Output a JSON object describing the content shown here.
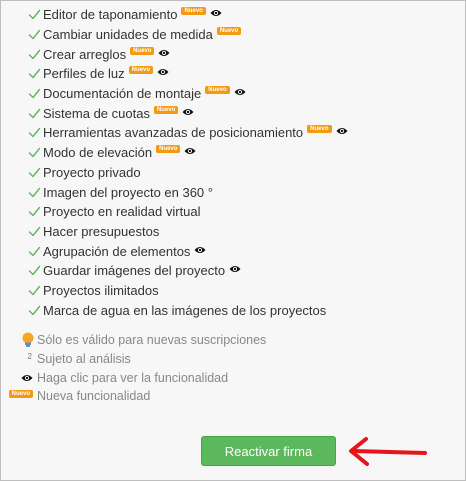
{
  "features": [
    {
      "label": "Editor de taponamiento",
      "new": true,
      "eye": true
    },
    {
      "label": "Cambiar unidades de medida",
      "new": true,
      "eye": false
    },
    {
      "label": "Crear arreglos",
      "new": true,
      "eye": true
    },
    {
      "label": "Perfiles de luz",
      "new": true,
      "eye": true
    },
    {
      "label": "Documentación de montaje",
      "new": true,
      "eye": true
    },
    {
      "label": "Sistema de cuotas",
      "new": true,
      "eye": true
    },
    {
      "label": "Herramientas avanzadas de posicionamiento",
      "new": true,
      "eye": true
    },
    {
      "label": "Modo de elevación",
      "new": true,
      "eye": true
    },
    {
      "label": "Proyecto privado",
      "new": false,
      "eye": false
    },
    {
      "label": "Imagen del proyecto en 360 °",
      "new": false,
      "eye": false
    },
    {
      "label": "Proyecto en realidad virtual",
      "new": false,
      "eye": false
    },
    {
      "label": "Hacer presupuestos",
      "new": false,
      "eye": false
    },
    {
      "label": "Agrupación de elementos",
      "new": false,
      "eye": true
    },
    {
      "label": "Guardar imágenes del proyecto",
      "new": false,
      "eye": true
    },
    {
      "label": "Proyectos ilimitados",
      "new": false,
      "eye": false
    },
    {
      "label": "Marca de agua en las imágenes de los proyectos",
      "new": false,
      "eye": false
    }
  ],
  "badge_text": "Nuevo",
  "notes": {
    "new_subscriptions": "Sólo es válido para nuevas suscripciones",
    "analysis_mark": "2",
    "analysis": "Sujeto al análisis",
    "click_to_see": "Haga clic para ver la funcionalidad",
    "new_feature": "Nueva funcionalidad"
  },
  "button": {
    "reactivate_label": "Reactivar firma"
  },
  "colors": {
    "check": "#5cb85c",
    "badge": "#f39a12",
    "button": "#5cb85c",
    "arrow": "#e8141c"
  },
  "icons": {
    "check": "checkmark-icon",
    "eye": "eye-icon",
    "bulb": "lightbulb-icon",
    "arrow": "red-arrow-annotation"
  }
}
